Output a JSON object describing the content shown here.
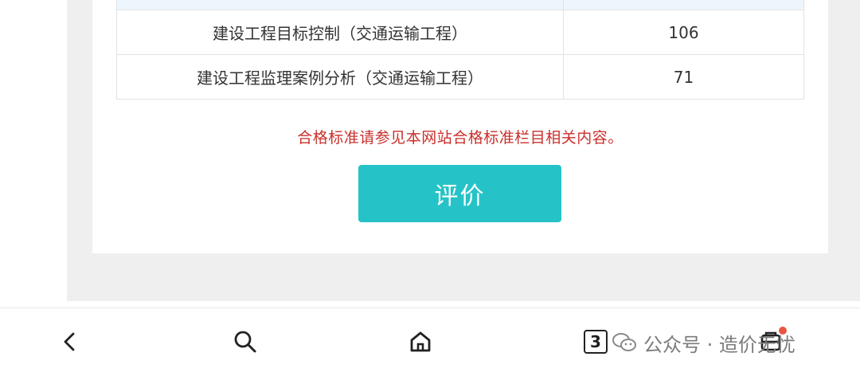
{
  "table": {
    "rows": [
      {
        "subject": "建设工程目标控制（交通运输工程）",
        "score": "106"
      },
      {
        "subject": "建设工程监理案例分析（交通运输工程）",
        "score": "71"
      }
    ]
  },
  "notice": "合格标准请参见本网站合格标准栏目相关内容。",
  "eval_button": "评价",
  "nav": {
    "tab_count": "3"
  },
  "watermark": {
    "text": "公众号 · 造价无忧"
  },
  "colors": {
    "accent": "#25c3c8",
    "notice": "#c9302c",
    "header_bg": "#eef6fd"
  },
  "icons": [
    "back-icon",
    "search-icon",
    "home-icon",
    "tabs-icon",
    "menu-icon",
    "wechat-icon"
  ]
}
